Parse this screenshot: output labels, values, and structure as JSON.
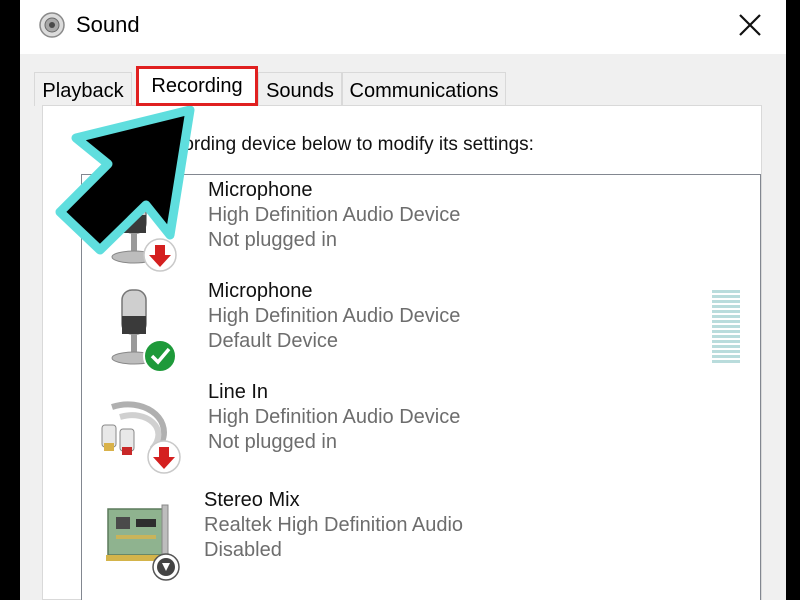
{
  "window": {
    "title": "Sound",
    "close_glyph": "✕",
    "icons": {
      "app": "speaker-icon",
      "close": "close-icon"
    }
  },
  "tabs": [
    {
      "label": "Playback",
      "active": false
    },
    {
      "label": "Recording",
      "active": true
    },
    {
      "label": "Sounds",
      "active": false
    },
    {
      "label": "Communications",
      "active": false
    }
  ],
  "panel": {
    "instruction": "Select a recording device below to modify its settings:"
  },
  "devices": [
    {
      "name": "Microphone",
      "description": "High Definition Audio Device",
      "status": "Not plugged in",
      "icon": "microphone-icon",
      "badge": "unplugged-badge",
      "level_meter": false
    },
    {
      "name": "Microphone",
      "description": "High Definition Audio Device",
      "status": "Default Device",
      "icon": "microphone-icon",
      "badge": "default-check-badge",
      "level_meter": true
    },
    {
      "name": "Line In",
      "description": "High Definition Audio Device",
      "status": "Not plugged in",
      "icon": "line-in-cable-icon",
      "badge": "unplugged-badge",
      "level_meter": false
    },
    {
      "name": "Stereo Mix",
      "description": "Realtek High Definition Audio",
      "status": "Disabled",
      "icon": "sound-card-icon",
      "badge": "disabled-badge",
      "level_meter": false
    }
  ],
  "colors": {
    "highlight_box": "#e02020",
    "arrow_fill": "#000000",
    "arrow_outline": "#5fdede",
    "unplugged_badge": "#d42020",
    "default_badge": "#1e9a3a",
    "level_meter": "#b9dcdc"
  },
  "annotation": {
    "icon": "pointer-arrow-icon"
  }
}
